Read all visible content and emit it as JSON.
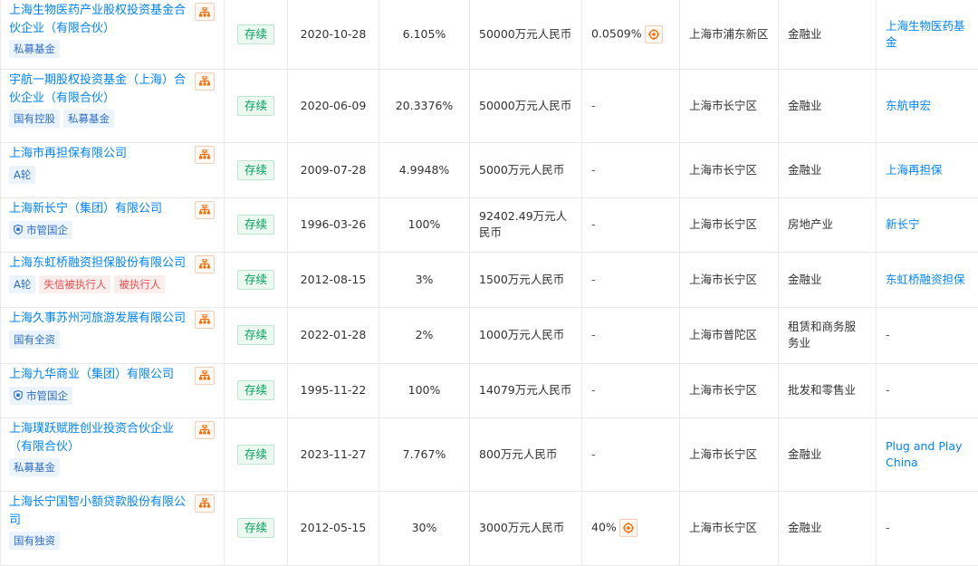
{
  "status_label": "存续",
  "rows": [
    {
      "name": "上海生物医药产业股权投资基金合伙企业（有限合伙）",
      "tags": [
        {
          "text": "私募基金",
          "style": "blue"
        }
      ],
      "date": "2020-10-28",
      "ratio": "6.105%",
      "capital": "50000万元人民币",
      "final_ratio": "0.0509%",
      "region": "上海市浦东新区",
      "industry": "金融业",
      "brand": "上海生物医药基金"
    },
    {
      "name": "宇航一期股权投资基金（上海）合伙企业（有限合伙）",
      "tags": [
        {
          "text": "国有控股",
          "style": "blue"
        },
        {
          "text": "私募基金",
          "style": "blue"
        }
      ],
      "date": "2020-06-09",
      "ratio": "20.3376%",
      "capital": "50000万元人民币",
      "final_ratio": "-",
      "region": "上海市长宁区",
      "industry": "金融业",
      "brand": "东航申宏"
    },
    {
      "name": "上海市再担保有限公司",
      "tags": [
        {
          "text": "A轮",
          "style": "blue"
        }
      ],
      "date": "2009-07-28",
      "ratio": "4.9948%",
      "capital": "5000万元人民币",
      "final_ratio": "-",
      "region": "上海市长宁区",
      "industry": "金融业",
      "brand": "上海再担保"
    },
    {
      "name": "上海新长宁（集团）有限公司",
      "tags": [
        {
          "text": "市管国企",
          "style": "blue",
          "icon": "shield-icon"
        }
      ],
      "date": "1996-03-26",
      "ratio": "100%",
      "capital": "92402.49万元人民币",
      "final_ratio": "-",
      "region": "上海市长宁区",
      "industry": "房地产业",
      "brand": "新长宁"
    },
    {
      "name": "上海东虹桥融资担保股份有限公司",
      "tags": [
        {
          "text": "A轮",
          "style": "blue"
        },
        {
          "text": "失信被执行人",
          "style": "red"
        },
        {
          "text": "被执行人",
          "style": "red"
        }
      ],
      "date": "2012-08-15",
      "ratio": "3%",
      "capital": "1500万元人民币",
      "final_ratio": "-",
      "region": "上海市长宁区",
      "industry": "金融业",
      "brand": "东虹桥融资担保"
    },
    {
      "name": "上海久事苏州河旅游发展有限公司",
      "tags": [
        {
          "text": "国有全资",
          "style": "blue"
        }
      ],
      "date": "2022-01-28",
      "ratio": "2%",
      "capital": "1000万元人民币",
      "final_ratio": "-",
      "region": "上海市普陀区",
      "industry": "租赁和商务服务业",
      "brand": "-"
    },
    {
      "name": "上海九华商业（集团）有限公司",
      "tags": [
        {
          "text": "市管国企",
          "style": "blue",
          "icon": "shield-icon"
        }
      ],
      "date": "1995-11-22",
      "ratio": "100%",
      "capital": "14079万元人民币",
      "final_ratio": "-",
      "region": "上海市长宁区",
      "industry": "批发和零售业",
      "brand": "-"
    },
    {
      "name": "上海璞跃赋胜创业投资合伙企业（有限合伙）",
      "tags": [
        {
          "text": "私募基金",
          "style": "blue"
        }
      ],
      "date": "2023-11-27",
      "ratio": "7.767%",
      "capital": "800万元人民币",
      "final_ratio": "-",
      "region": "上海市长宁区",
      "industry": "金融业",
      "brand": "Plug and Play China"
    },
    {
      "name": "上海长宁国智小额贷款股份有限公司",
      "tags": [
        {
          "text": "国有独资",
          "style": "blue"
        }
      ],
      "date": "2012-05-15",
      "ratio": "30%",
      "capital": "3000万元人民币",
      "final_ratio": "40%",
      "region": "上海市长宁区",
      "industry": "金融业",
      "brand": "-"
    }
  ],
  "row_heights": [
    76,
    81,
    61,
    60,
    61,
    62,
    60,
    81,
    82
  ]
}
